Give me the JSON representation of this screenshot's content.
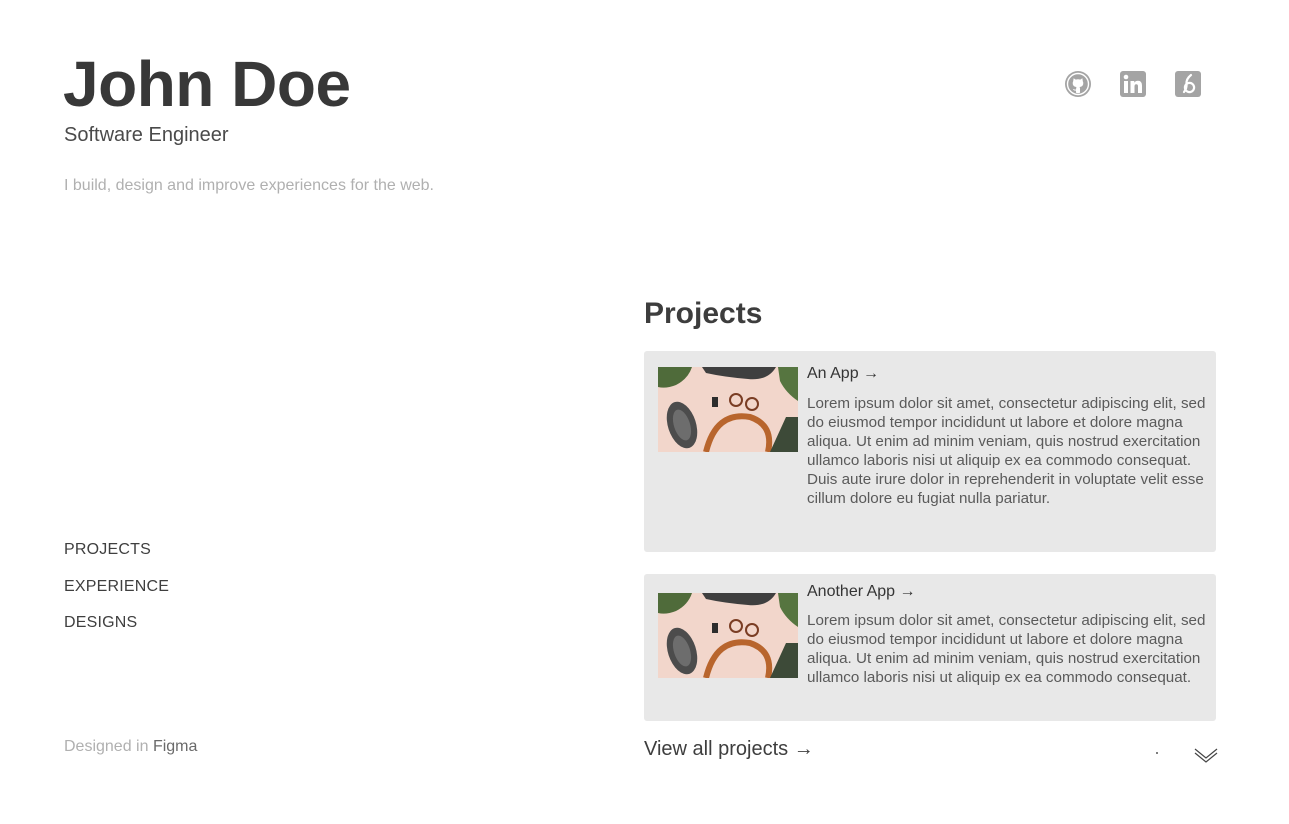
{
  "profile": {
    "name": "John Doe",
    "role": "Software Engineer",
    "tagline": "I build, design and improve experiences for the web."
  },
  "socials": [
    {
      "icon": "github-icon"
    },
    {
      "icon": "linkedin-icon"
    },
    {
      "icon": "dribbble-icon"
    }
  ],
  "nav": {
    "projects": "PROJECTS",
    "experience": "EXPERIENCE",
    "designs": "DESIGNS"
  },
  "footer": {
    "prefix": "Designed in ",
    "brand": "Figma"
  },
  "projects": {
    "title": "Projects",
    "items": [
      {
        "title": "An App →",
        "description": "Lorem ipsum dolor sit amet, consectetur adipiscing elit, sed do eiusmod tempor incididunt ut labore et dolore magna aliqua. Ut enim ad minim veniam, quis nostrud exercitation ullamco laboris nisi ut aliquip ex ea commodo consequat. Duis aute irure dolor in reprehenderit in voluptate velit esse cillum dolore eu fugiat nulla pariatur."
      },
      {
        "title": "Another App →",
        "description": "Lorem ipsum dolor sit amet, consectetur adipiscing elit, sed do eiusmod tempor incididunt ut labore et dolore magna aliqua. Ut enim ad minim veniam, quis nostrud exercitation ullamco laboris nisi ut aliquip ex ea commodo consequat."
      }
    ],
    "view_all": "View all projects →"
  },
  "colors": {
    "card_bg": "#e8e8e8",
    "text_dark": "#383838",
    "text_muted": "#b0b0b0"
  }
}
